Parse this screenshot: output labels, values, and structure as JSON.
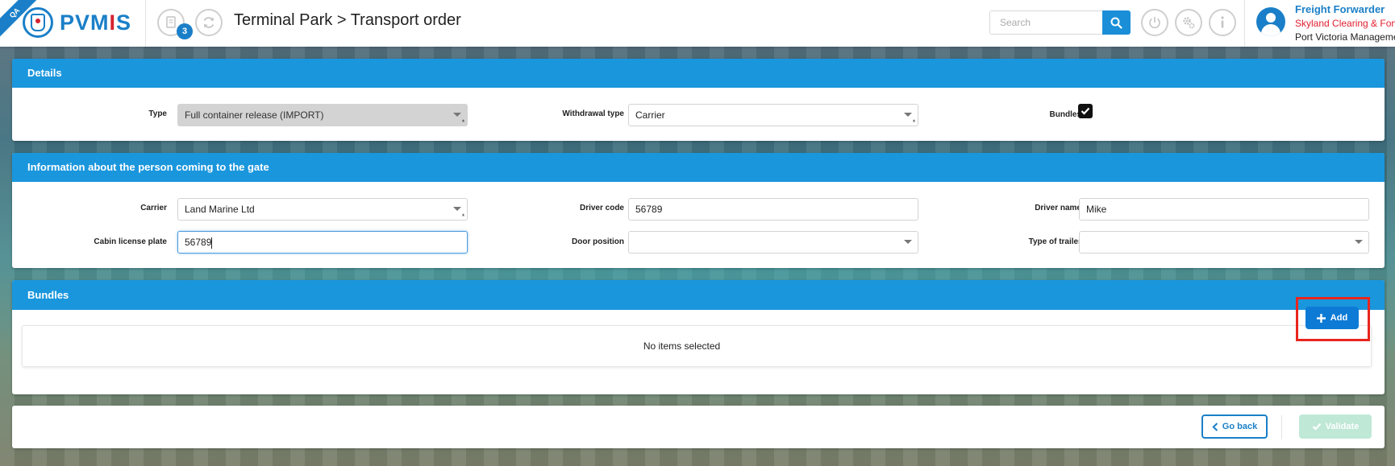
{
  "header": {
    "env_badge": "QA",
    "logo": {
      "prefix": "PVM",
      "accent": "I",
      "suffix": "S"
    },
    "notifications_count": "3",
    "page_title": "Terminal Park > Transport order",
    "search": {
      "placeholder": "Search",
      "value": ""
    },
    "user": {
      "role": "Freight Forwarder",
      "company": "Skyland Clearing & Forwarding",
      "organization": "Port Victoria Management"
    }
  },
  "details": {
    "title": "Details",
    "type_label": "Type",
    "type_value": "Full container release (IMPORT)",
    "withdrawal_label": "Withdrawal type",
    "withdrawal_value": "Carrier",
    "bundles_label": "Bundles",
    "bundles_checked": true
  },
  "person": {
    "title": "Information about the person coming to the gate",
    "carrier_label": "Carrier",
    "carrier_value": "Land Marine Ltd",
    "driver_code_label": "Driver code",
    "driver_code_value": "56789",
    "driver_name_label": "Driver name",
    "driver_name_value": "Mike",
    "cabin_plate_label": "Cabin license plate",
    "cabin_plate_value": "56789",
    "door_position_label": "Door position",
    "door_position_value": "",
    "trailer_type_label": "Type of trailer",
    "trailer_type_value": ""
  },
  "bundles": {
    "title": "Bundles",
    "empty_text": "No items selected",
    "add_label": "Add"
  },
  "footer": {
    "back_label": "Go back",
    "validate_label": "Validate"
  },
  "colors": {
    "brand": "#1a7fc8",
    "panel_header": "#1a96dd",
    "highlight": "#e8261e",
    "validate_disabled": "#bfe8d6"
  }
}
